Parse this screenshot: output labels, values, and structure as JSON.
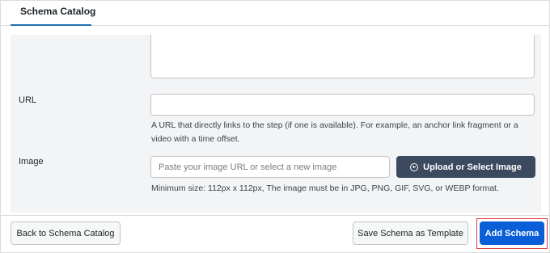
{
  "tabs": [
    {
      "label": "Schema Catalog",
      "active": true
    }
  ],
  "form": {
    "url": {
      "label": "URL",
      "value": "",
      "help": "A URL that directly links to the step (if one is available). For example, an anchor link fragment or a video with a time offset."
    },
    "image": {
      "label": "Image",
      "placeholder": "Paste your image URL or select a new image",
      "upload_label": "Upload or Select Image",
      "upload_icon": "plus-circle-icon",
      "help": "Minimum size: 112px x 112px, The image must be in JPG, PNG, GIF, SVG, or WEBP format."
    }
  },
  "footer": {
    "back_label": "Back to Schema Catalog",
    "template_label": "Save Schema as Template",
    "add_label": "Add Schema"
  },
  "colors": {
    "accent": "#2271b1",
    "primary_button": "#0a5fd8",
    "upload_button": "#3c4a60",
    "highlight": "#e23a3a",
    "panel_background": "#f3f4f6"
  }
}
